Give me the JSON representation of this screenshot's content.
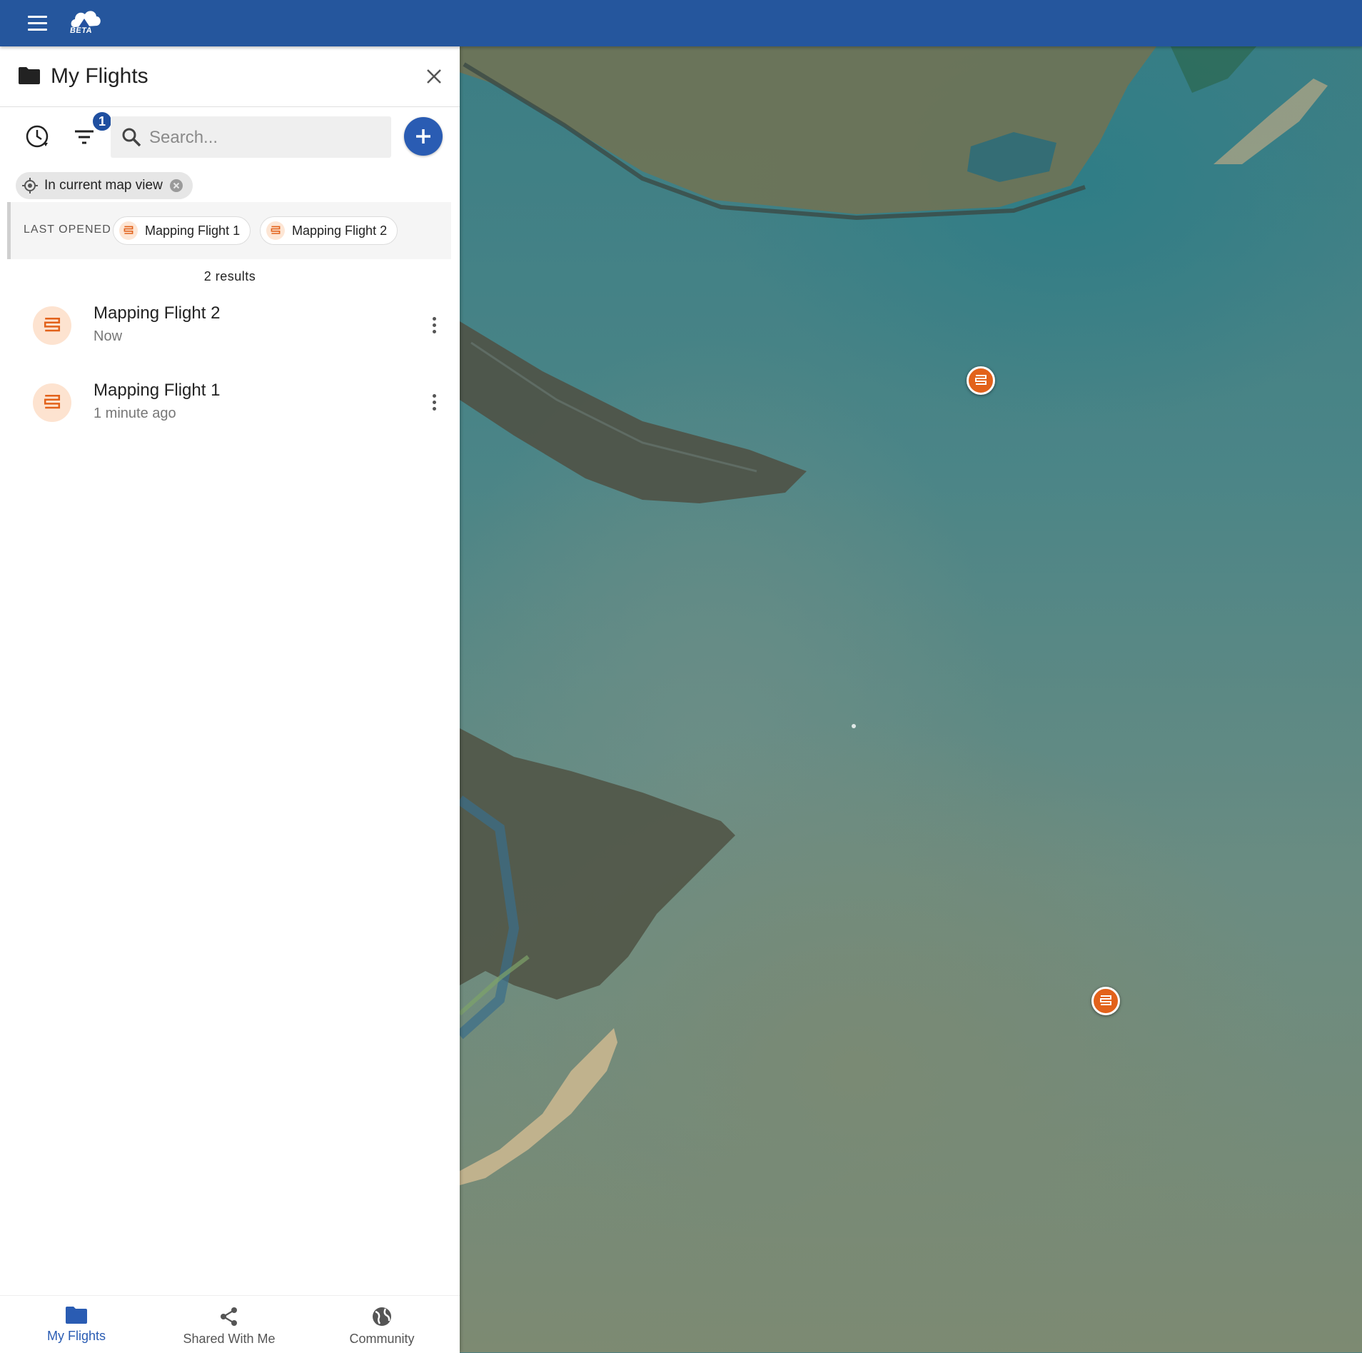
{
  "app": {
    "logo_badge": "BETA",
    "brand_color": "#2451a0",
    "accent_color": "#e2621b"
  },
  "panel": {
    "title": "My Flights",
    "filter_badge_count": "1",
    "search": {
      "placeholder": "Search...",
      "value": ""
    },
    "active_filter_chip": "In current map view",
    "last_opened": {
      "label": "LAST OPENED",
      "items": [
        "Mapping Flight 1",
        "Mapping Flight 2"
      ]
    },
    "results_count": "2 results",
    "flights": [
      {
        "name": "Mapping Flight 2",
        "time": "Now"
      },
      {
        "name": "Mapping Flight 1",
        "time": "1 minute ago"
      }
    ]
  },
  "bottom_nav": {
    "items": [
      {
        "label": "My Flights",
        "icon": "folder-icon",
        "active": true
      },
      {
        "label": "Shared With Me",
        "icon": "share-icon",
        "active": false
      },
      {
        "label": "Community",
        "icon": "globe-icon",
        "active": false
      }
    ]
  },
  "map": {
    "markers": [
      {
        "label": "Mapping Flight",
        "icon": "mapping-flight-icon"
      },
      {
        "label": "Mapping Flight",
        "icon": "mapping-flight-icon"
      }
    ]
  }
}
